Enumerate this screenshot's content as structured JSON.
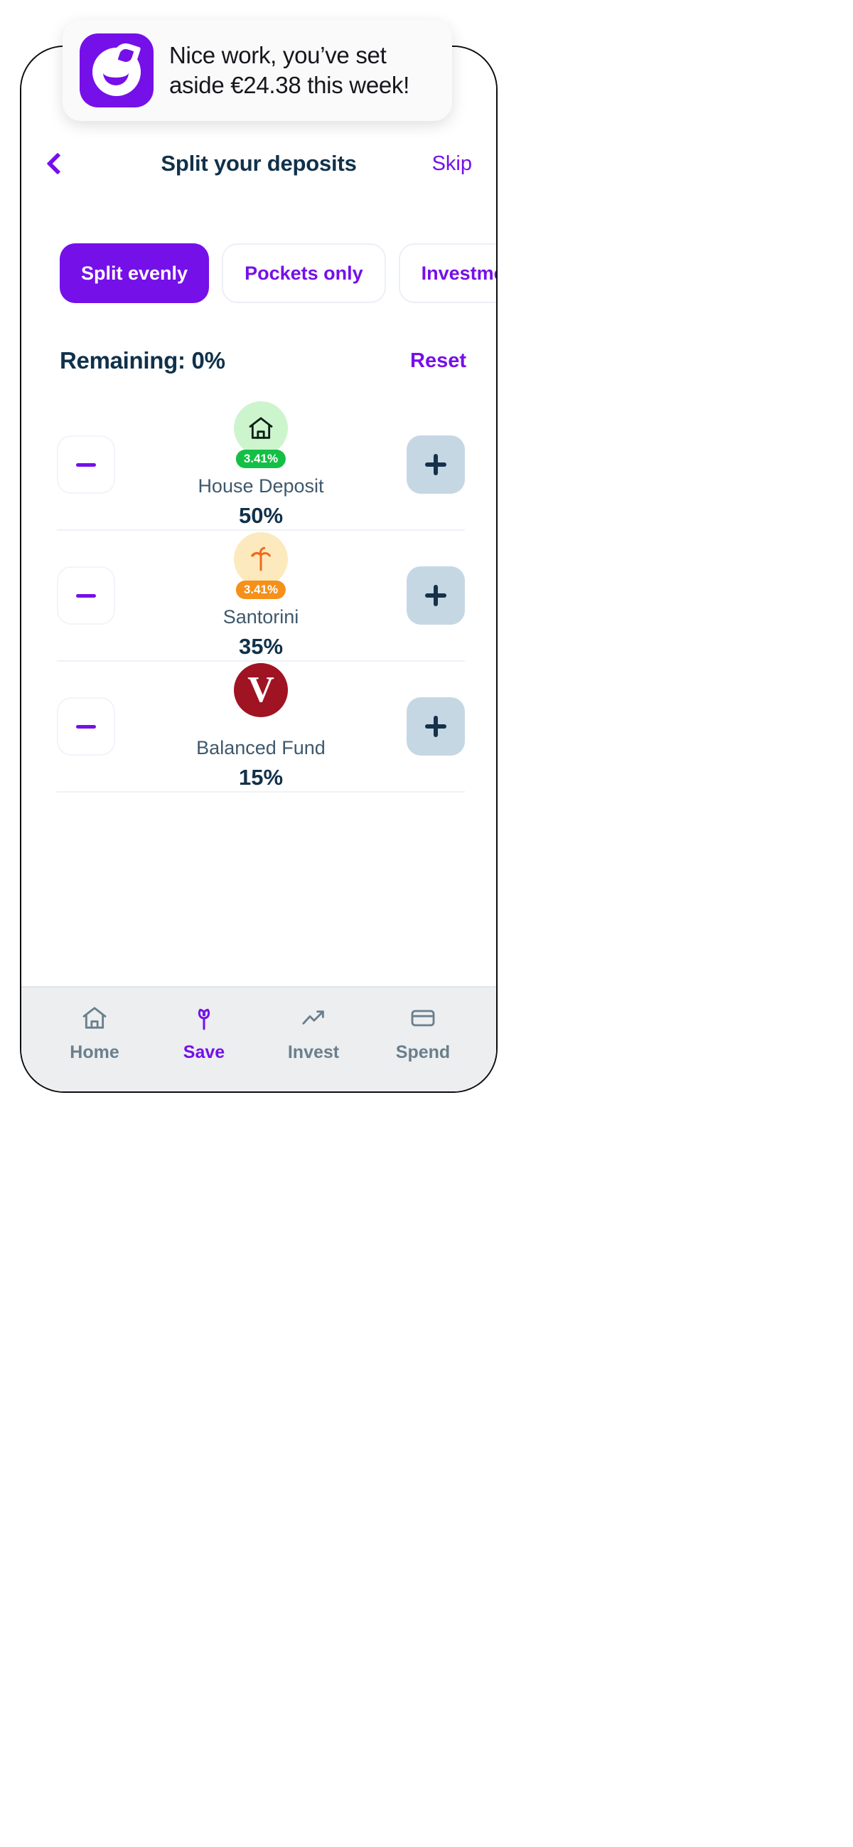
{
  "notification": {
    "icon_name": "app-logo-icon",
    "message": "Nice work, you’ve set aside €24.38 this week!"
  },
  "header": {
    "back_icon": "chevron-left-icon",
    "title": "Split your deposits",
    "skip_label": "Skip"
  },
  "tabs": [
    {
      "label": "Split evenly",
      "active": true
    },
    {
      "label": "Pockets only",
      "active": false
    },
    {
      "label": "Investments",
      "active": false
    }
  ],
  "summary": {
    "remaining_label": "Remaining: 0%",
    "reset_label": "Reset"
  },
  "pockets": [
    {
      "name": "House Deposit",
      "percent": "50%",
      "badge": "3.41%",
      "icon_name": "house-icon",
      "avatar_class": "av-green",
      "badge_class": "bg-green",
      "decrease_label": "−",
      "increase_label": "+"
    },
    {
      "name": "Santorini",
      "percent": "35%",
      "badge": "3.41%",
      "icon_name": "palm-tree-icon",
      "avatar_class": "av-amber",
      "badge_class": "bg-amber",
      "decrease_label": "−",
      "increase_label": "+"
    },
    {
      "name": "Balanced Fund",
      "percent": "15%",
      "badge": "",
      "icon_name": "vanguard-logo-icon",
      "avatar_class": "av-red",
      "badge_class": "",
      "decrease_label": "−",
      "increase_label": "+"
    }
  ],
  "bottom_nav": [
    {
      "label": "Home",
      "icon": "home-icon",
      "active": false
    },
    {
      "label": "Save",
      "icon": "sprout-icon",
      "active": true
    },
    {
      "label": "Invest",
      "icon": "chart-line-icon",
      "active": false
    },
    {
      "label": "Spend",
      "icon": "card-icon",
      "active": false
    }
  ],
  "colors": {
    "brand_purple": "#7510E8",
    "navy": "#10314a",
    "green": "#14bf45",
    "amber": "#f59019",
    "vanguard_red": "#9f1322"
  }
}
